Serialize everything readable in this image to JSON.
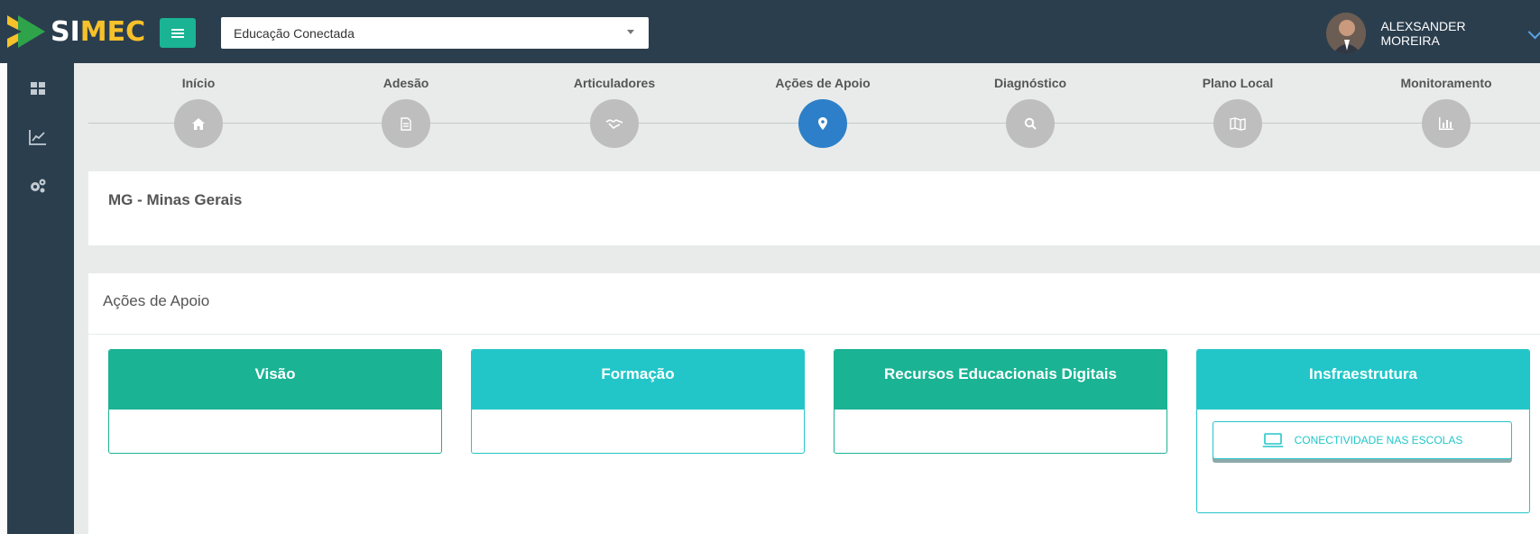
{
  "header": {
    "logo_si": "SI",
    "logo_mec": "MEC",
    "program_select": "Educação Conectada",
    "user_name": "ALEXSANDER MOREIRA"
  },
  "sidebar": {
    "items": [
      {
        "icon": "dashboard-grid-icon"
      },
      {
        "icon": "line-chart-icon"
      },
      {
        "icon": "gears-icon"
      }
    ]
  },
  "steps": [
    {
      "label": "Início",
      "icon": "home-icon",
      "active": false
    },
    {
      "label": "Adesão",
      "icon": "document-icon",
      "active": false
    },
    {
      "label": "Articuladores",
      "icon": "handshake-icon",
      "active": false
    },
    {
      "label": "Ações de Apoio",
      "icon": "map-marker-icon",
      "active": true
    },
    {
      "label": "Diagnóstico",
      "icon": "search-icon",
      "active": false
    },
    {
      "label": "Plano Local",
      "icon": "map-icon",
      "active": false
    },
    {
      "label": "Monitoramento",
      "icon": "bar-chart-icon",
      "active": false
    }
  ],
  "state": "MG - Minas Gerais",
  "acoes": {
    "title": "Ações de Apoio",
    "cards": [
      {
        "title": "Visão"
      },
      {
        "title": "Formação"
      },
      {
        "title": "Recursos Educacionais Digitais"
      },
      {
        "title": "Insfraestrutura",
        "button": "CONECTIVIDADE NAS ESCOLAS"
      }
    ]
  },
  "colors": {
    "topbar": "#2b3e4e",
    "green": "#1ab394",
    "teal": "#23c6c8",
    "active_step": "#2d7fc9",
    "inactive_step": "#bebebe"
  }
}
